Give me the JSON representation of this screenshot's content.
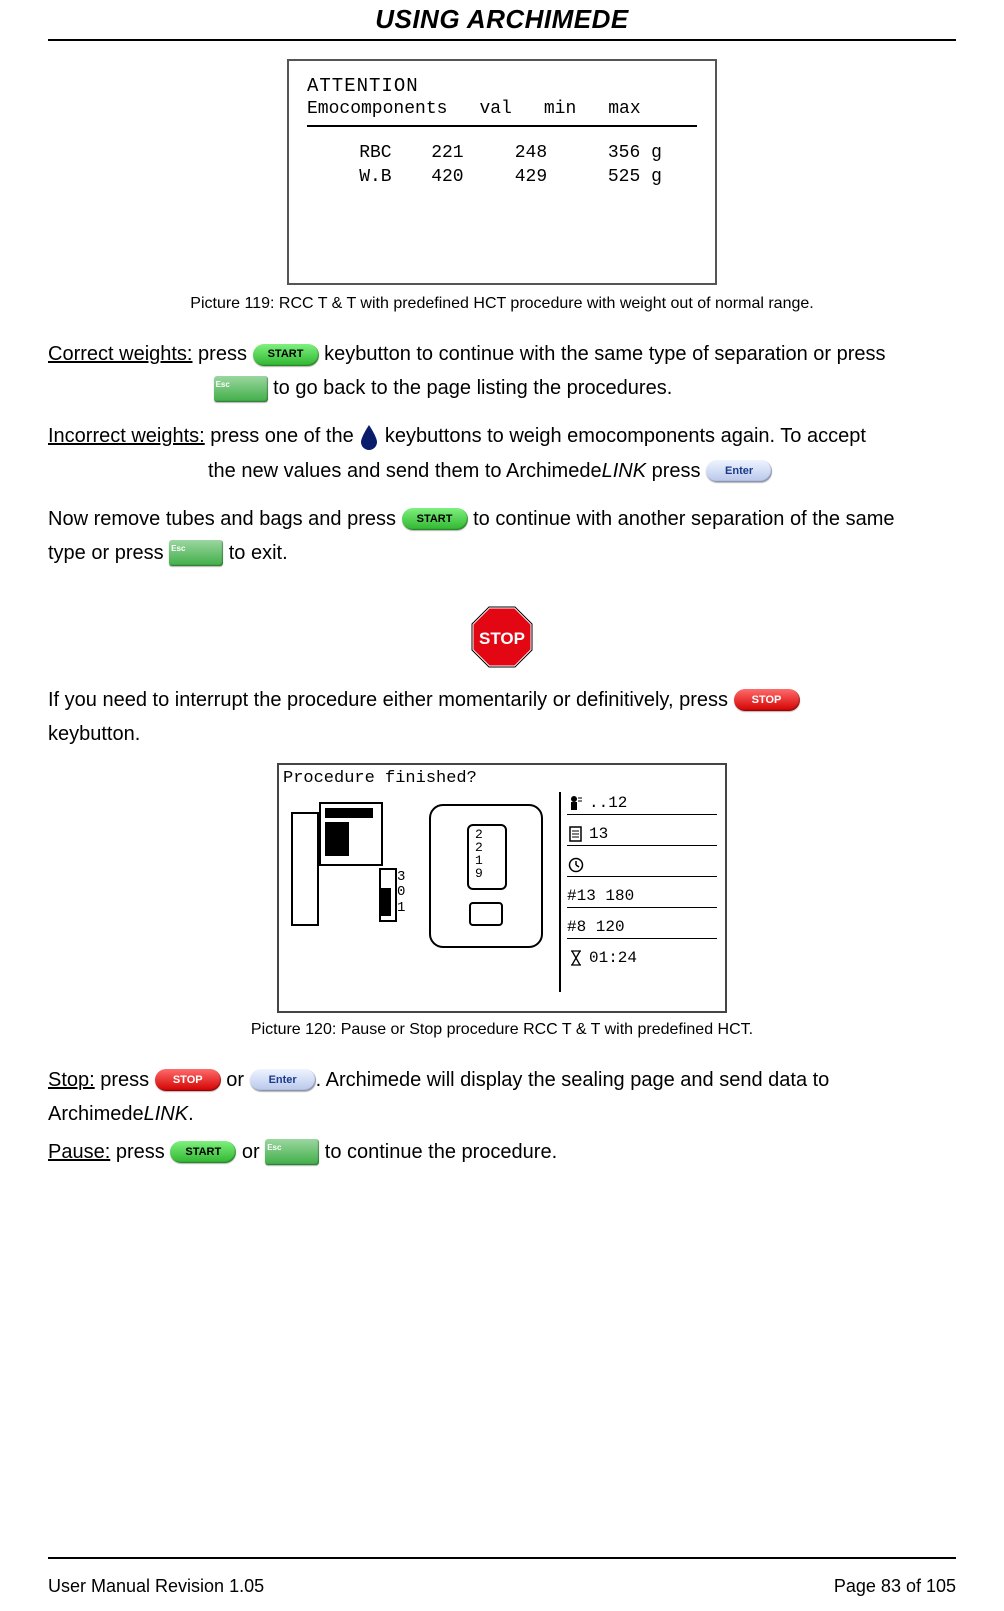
{
  "header": {
    "title": "USING ARCHIMEDE"
  },
  "figure1": {
    "attention": "ATTENTION",
    "emo_label": "Emocomponents",
    "cols": {
      "val": "val",
      "min": "min",
      "max": "max"
    },
    "rows": [
      {
        "name": "RBC",
        "val": "221",
        "min": "248",
        "max": "356",
        "unit": "g"
      },
      {
        "name": "W.B",
        "val": "420",
        "min": "429",
        "max": "525",
        "unit": "g"
      }
    ],
    "caption": "Picture 119: RCC T & T  with predefined HCT procedure with weight out of normal range."
  },
  "buttons": {
    "start": "START",
    "stop": "STOP",
    "enter": "Enter",
    "esc": "Esc"
  },
  "text": {
    "correct_label": "Correct weights:",
    "correct_1a": "  press ",
    "correct_1b": " keybutton to continue with the same type of separation or press",
    "correct_2a": " to go back to the page listing the procedures.",
    "incorrect_label": "Incorrect weights:",
    "incorrect_1a": "    press one of the ",
    "incorrect_1b": " keybuttons to weigh emocomponents again. To accept",
    "incorrect_2a": "the new values and send them to Archimede",
    "incorrect_2_link": "LINK",
    "incorrect_2b": " press ",
    "remove_1a": "Now remove tubes and bags and press ",
    "remove_1b": " to continue with another separation of the same",
    "remove_2a": "type or press ",
    "remove_2b": " to exit.",
    "interrupt_1a": "If you need to interrupt the procedure either momentarily or definitively, press ",
    "interrupt_2a": "keybutton.",
    "stop_label": "Stop:",
    "stop_1a": " press ",
    "stop_1b": " or ",
    "stop_1c": ". Archimede will display the sealing page and send data to",
    "stop_2a": "Archimede",
    "stop_2_link": "LINK",
    "stop_2b": ".",
    "pause_label": "Pause:",
    "pause_1a": " press ",
    "pause_1b": " or ",
    "pause_1c": " to continue the procedure."
  },
  "figure2": {
    "title": "Procedure finished?",
    "side": {
      "a": "..12",
      "b": "13",
      "c": "",
      "d": "#13 180",
      "e": "#8 120",
      "f": "01:24"
    },
    "left_nums_a": "3",
    "left_nums_b": "0",
    "left_nums_c": "1",
    "box_nums": "2\n2\n1\n9",
    "caption": "Picture 120: Pause or Stop procedure RCC T & T  with predefined HCT."
  },
  "footer": {
    "left": "User Manual Revision 1.05",
    "right": "Page 83 of 105"
  }
}
